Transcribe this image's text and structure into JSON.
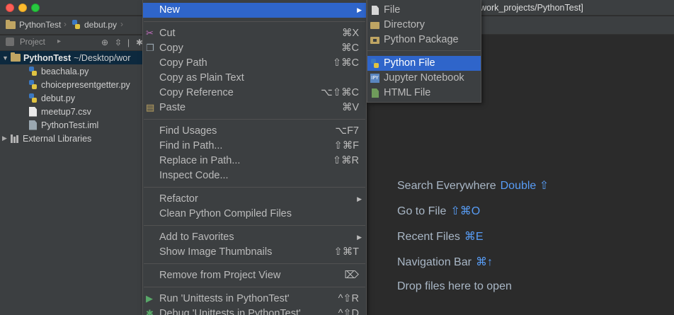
{
  "window": {
    "title": "work_projects/PythonTest]"
  },
  "breadcrumb": {
    "project": "PythonTest",
    "file": "debut.py"
  },
  "project_panel": {
    "header_label": "Project",
    "root_name": "PythonTest",
    "root_path": "~/Desktop/wor",
    "files": [
      {
        "name": "beachala.py",
        "icon": "python-file-icon"
      },
      {
        "name": "choicepresentgetter.py",
        "icon": "python-file-icon"
      },
      {
        "name": "debut.py",
        "icon": "python-file-icon"
      },
      {
        "name": "meetup7.csv",
        "icon": "text-file-icon"
      },
      {
        "name": "PythonTest.iml",
        "icon": "module-file-icon"
      }
    ],
    "external_libraries": "External Libraries"
  },
  "context_menu": {
    "new": "New",
    "cut": {
      "label": "Cut",
      "key": "⌘X"
    },
    "copy": {
      "label": "Copy",
      "key": "⌘C"
    },
    "copy_path": {
      "label": "Copy Path",
      "key": "⇧⌘C"
    },
    "copy_plain": {
      "label": "Copy as Plain Text",
      "key": ""
    },
    "copy_reference": {
      "label": "Copy Reference",
      "key": "⌥⇧⌘C"
    },
    "paste": {
      "label": "Paste",
      "key": "⌘V"
    },
    "find_usages": {
      "label": "Find Usages",
      "key": "⌥F7"
    },
    "find_in_path": {
      "label": "Find in Path...",
      "key": "⇧⌘F"
    },
    "replace_in_path": {
      "label": "Replace in Path...",
      "key": "⇧⌘R"
    },
    "inspect_code": {
      "label": "Inspect Code...",
      "key": ""
    },
    "refactor": "Refactor",
    "clean_compiled": "Clean Python Compiled Files",
    "add_favorites": "Add to Favorites",
    "show_thumbnails": {
      "label": "Show Image Thumbnails",
      "key": "⇧⌘T"
    },
    "remove_from_view": {
      "label": "Remove from Project View",
      "key": "⌦"
    },
    "run": {
      "label": "Run 'Unittests in PythonTest'",
      "key": "^⇧R"
    },
    "debug": {
      "label": "Debug 'Unittests in PythonTest'",
      "key": "^⇧D"
    }
  },
  "new_submenu": {
    "items": [
      "File",
      "Directory",
      "Python Package",
      "Python File",
      "Jupyter Notebook",
      "HTML File"
    ],
    "selected": "Python File"
  },
  "editor_hints": [
    {
      "label": "Search Everywhere",
      "shortcut": "Double ⇧"
    },
    {
      "label": "Go to File",
      "shortcut": "⇧⌘O"
    },
    {
      "label": "Recent Files",
      "shortcut": "⌘E"
    },
    {
      "label": "Navigation Bar",
      "shortcut": "⌘↑"
    },
    {
      "label": "Drop files here to open",
      "shortcut": ""
    }
  ],
  "colors": {
    "selection": "#2f65ca",
    "shortcut_accent": "#589df6",
    "panel_bg": "#3c3f41",
    "editor_bg": "#2b2b2b"
  }
}
